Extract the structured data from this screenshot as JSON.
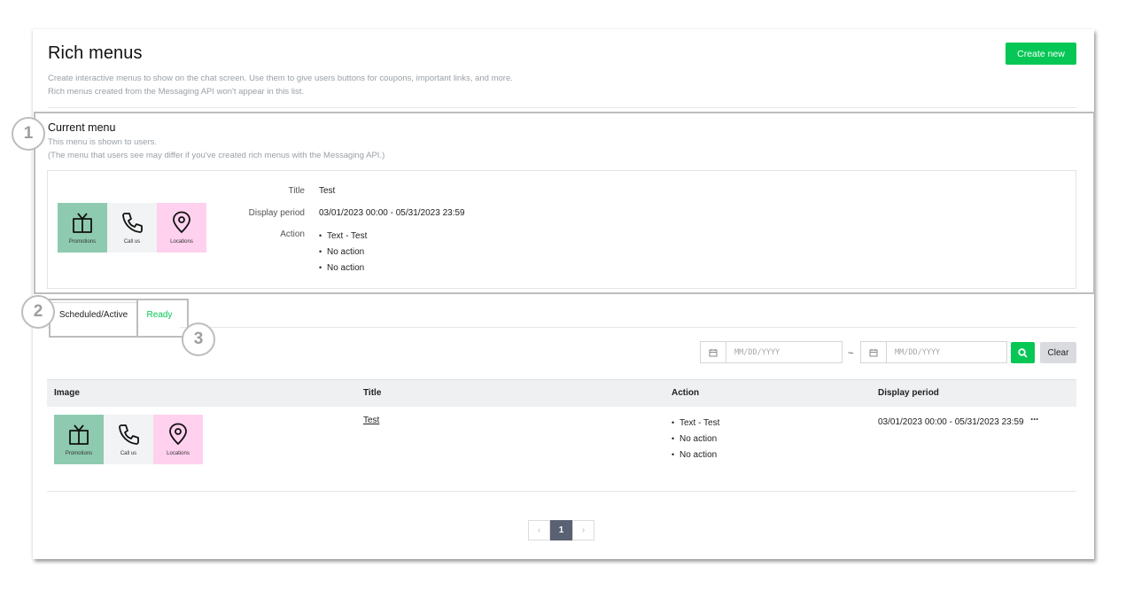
{
  "header": {
    "title": "Rich menus",
    "desc_line1": "Create interactive menus to show on the chat screen. Use them to give users buttons for coupons, important links, and more.",
    "desc_line2": "Rich menus created from the Messaging API won't appear in this list.",
    "create_label": "Create new"
  },
  "current_menu": {
    "heading": "Current menu",
    "sub_line1": "This menu is shown to users.",
    "sub_line2": "(The menu that users see may differ if you've created rich menus with the Messaging API.)",
    "title_label": "Title",
    "title_value": "Test",
    "period_label": "Display period",
    "period_value": "03/01/2023 00:00 - 05/31/2023 23:59",
    "action_label": "Action",
    "actions": [
      "Text - Test",
      "No action",
      "No action"
    ]
  },
  "menu_cells": [
    {
      "label": "Promotions",
      "icon": "gift-icon",
      "color": "#8ecab0"
    },
    {
      "label": "Call us",
      "icon": "phone-icon",
      "color": "#f2f3f4"
    },
    {
      "label": "Locations",
      "icon": "location-pin-icon",
      "color": "#ffd1ee"
    }
  ],
  "tabs": {
    "scheduled": "Scheduled/Active",
    "ready": "Ready"
  },
  "markers": {
    "one": "1",
    "two": "2",
    "three": "3"
  },
  "filter": {
    "start_placeholder": "MM/DD/YYYY",
    "end_placeholder": "MM/DD/YYYY",
    "separator": "~",
    "clear_label": "Clear"
  },
  "table": {
    "columns": [
      "Image",
      "Title",
      "Action",
      "Display period"
    ],
    "rows": [
      {
        "title": "Test",
        "actions": [
          "Text - Test",
          "No action",
          "No action"
        ],
        "period": "03/01/2023 00:00 - 05/31/2023 23:59",
        "more": "···"
      }
    ]
  },
  "pagination": {
    "prev": "‹",
    "current": "1",
    "next": "›"
  },
  "colors": {
    "accent": "#06c755",
    "highlight_border": "#bdbdbd",
    "pager_active": "#5a6173"
  }
}
